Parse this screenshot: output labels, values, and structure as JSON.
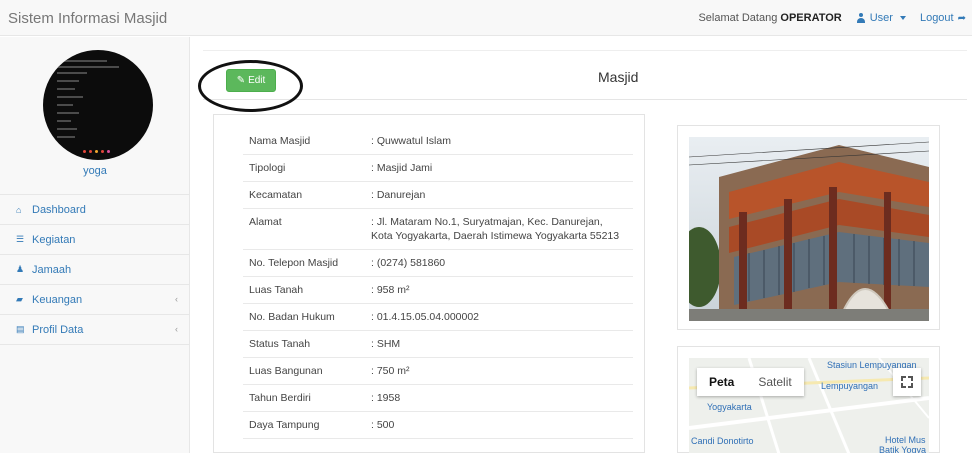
{
  "navbar": {
    "brand": "Sistem Informasi Masjid",
    "welcome_text": "Selamat Datang",
    "role": "OPERATOR",
    "user_label": "User",
    "logout_label": "Logout"
  },
  "sidebar": {
    "username": "yoga",
    "items": [
      {
        "label": "Dashboard",
        "icon": "home-icon"
      },
      {
        "label": "Kegiatan",
        "icon": "list-icon"
      },
      {
        "label": "Jamaah",
        "icon": "users-icon"
      },
      {
        "label": "Keuangan",
        "icon": "book-icon"
      },
      {
        "label": "Profil Data",
        "icon": "file-icon"
      }
    ]
  },
  "panel": {
    "edit_label": "Edit",
    "title": "Masjid"
  },
  "info": {
    "rows": [
      {
        "key": "Nama Masjid",
        "value": ": Quwwatul Islam"
      },
      {
        "key": "Tipologi",
        "value": ": Masjid Jami"
      },
      {
        "key": "Kecamatan",
        "value": ": Danurejan"
      },
      {
        "key": "Alamat",
        "value": ": Jl. Mataram No.1, Suryatmajan, Kec. Danurejan, Kota Yogyakarta, Daerah Istimewa Yogyakarta 55213"
      },
      {
        "key": "No. Telepon Masjid",
        "value": ": (0274) 581860"
      },
      {
        "key": "Luas Tanah",
        "value": ": 958 m²"
      },
      {
        "key": "No. Badan Hukum",
        "value": ": 01.4.15.05.04.000002"
      },
      {
        "key": "Status Tanah",
        "value": ": SHM"
      },
      {
        "key": "Luas Bangunan",
        "value": ": 750 m²"
      },
      {
        "key": "Tahun Berdiri",
        "value": ": 1958"
      },
      {
        "key": "Daya Tampung",
        "value": ": 500"
      }
    ]
  },
  "map": {
    "tab_map": "Peta",
    "tab_satellite": "Satelit",
    "labels": {
      "station": "Stasiun Lempuyangan",
      "lempuyangan": "Lempuyangan",
      "yogyakarta": "Yogyakarta",
      "candi": "Candi Donotirto",
      "hotel": "Hotel Mus",
      "batik": "Batik Yogya"
    }
  }
}
